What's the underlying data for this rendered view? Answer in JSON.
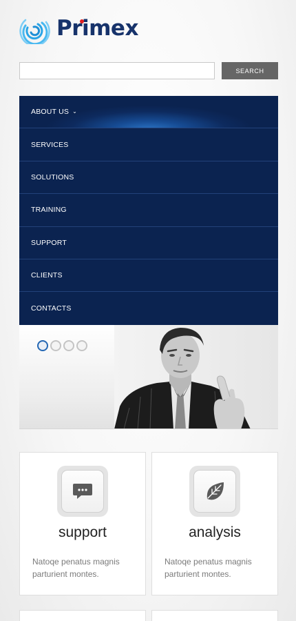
{
  "brand": {
    "name": "Primex",
    "logo_icon": "spiral-logo-icon",
    "colors": {
      "brand_blue": "#17336b",
      "dot_red": "#e02020",
      "logo_cyan": "#1f8fd6"
    }
  },
  "search": {
    "placeholder": "",
    "value": "",
    "button_label": "SEARCH"
  },
  "nav": {
    "items": [
      {
        "label": "ABOUT US",
        "active": true,
        "has_dropdown": true
      },
      {
        "label": "SERVICES"
      },
      {
        "label": "SOLUTIONS"
      },
      {
        "label": "TRAINING"
      },
      {
        "label": "SUPPORT"
      },
      {
        "label": "CLIENTS"
      },
      {
        "label": "CONTACTS"
      }
    ],
    "colors": {
      "background": "#0b2350",
      "divider": "#23427a",
      "active_glow": "#2a72c2"
    }
  },
  "slider": {
    "dot_count": 4,
    "active_dot": 1,
    "image": "businessman-pointing-image"
  },
  "features": [
    {
      "icon": "speech-bubble-icon",
      "title": "support",
      "text": "Natoqe penatus magnis parturient montes."
    },
    {
      "icon": "leaf-icon",
      "title": "analysis",
      "text": "Natoqe penatus magnis parturient montes."
    }
  ]
}
